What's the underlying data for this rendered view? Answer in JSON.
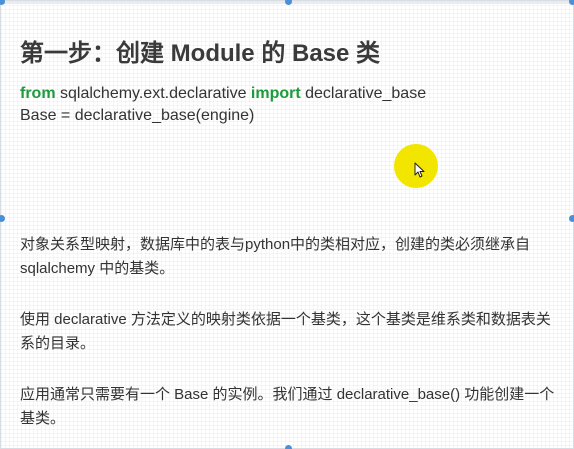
{
  "slide": {
    "title": "第一步：创建 Module 的 Base 类",
    "code": {
      "line1": {
        "kw_from": "from",
        "module": " sqlalchemy.ext.declarative ",
        "kw_import": "import",
        "name": " declarative_base"
      },
      "line2": "Base = declarative_base(engine)"
    },
    "paragraphs": [
      "对象关系型映射，数据库中的表与python中的类相对应，创建的类必须继承自 sqlalchemy 中的基类。",
      "使用 declarative 方法定义的映射类依据一个基类，这个基类是维系类和数据表关系的目录。",
      "应用通常只需要有一个 Base 的实例。我们通过 declarative_base() 功能创建一个基类。"
    ]
  },
  "colors": {
    "keyword": "#1e9a3c",
    "title": "#3a3a3a",
    "text": "#333333",
    "cursor_highlight": "#f2e600",
    "selection_handle": "#4a90d9"
  },
  "icons": {
    "cursor": "mouse-pointer-icon"
  }
}
